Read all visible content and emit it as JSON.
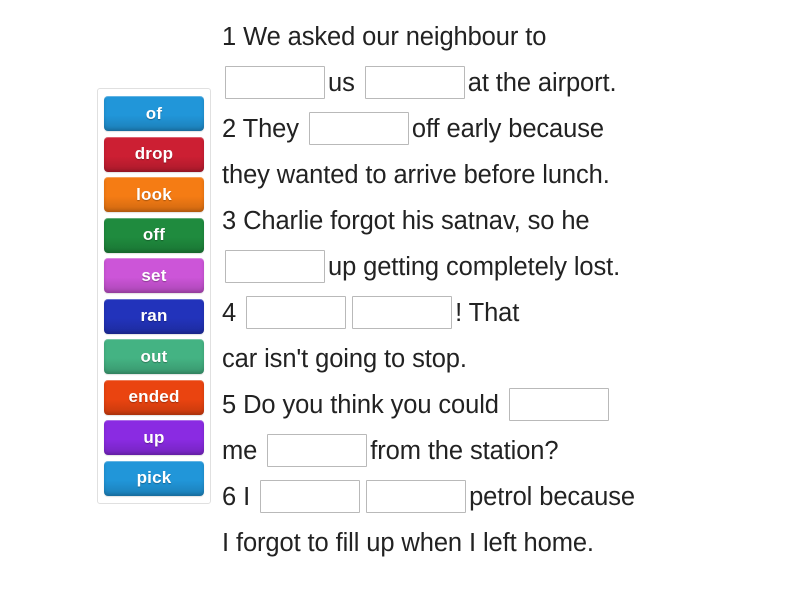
{
  "word_bank": {
    "name": "word-bank",
    "tiles": [
      {
        "label": "of",
        "color": "#2196d9"
      },
      {
        "label": "drop",
        "color": "#cc1f33"
      },
      {
        "label": "look",
        "color": "#f57c14"
      },
      {
        "label": "off",
        "color": "#1f8b3e"
      },
      {
        "label": "set",
        "color": "#cc55d8"
      },
      {
        "label": "ran",
        "color": "#2233bb"
      },
      {
        "label": "out",
        "color": "#44b383"
      },
      {
        "label": "ended",
        "color": "#ea4410"
      },
      {
        "label": "up",
        "color": "#8a2be2"
      },
      {
        "label": "pick",
        "color": "#2196d9"
      }
    ]
  },
  "exercise": {
    "lines": [
      {
        "number": "1",
        "segments": [
          {
            "type": "text",
            "value": "1 We asked our neighbour to"
          }
        ]
      },
      {
        "number": "1b",
        "segments": [
          {
            "type": "blank",
            "value": ""
          },
          {
            "type": "text",
            "value": "us"
          },
          {
            "type": "blank",
            "value": ""
          },
          {
            "type": "text",
            "value": "at the airport."
          }
        ]
      },
      {
        "number": "2",
        "segments": [
          {
            "type": "text",
            "value": "2 They"
          },
          {
            "type": "blank",
            "value": ""
          },
          {
            "type": "text",
            "value": "off early because"
          }
        ]
      },
      {
        "number": "2b",
        "segments": [
          {
            "type": "text",
            "value": "they wanted to arrive before lunch."
          }
        ]
      },
      {
        "number": "3",
        "segments": [
          {
            "type": "text",
            "value": "3 Charlie forgot his satnav, so he"
          }
        ]
      },
      {
        "number": "3b",
        "segments": [
          {
            "type": "blank",
            "value": ""
          },
          {
            "type": "text",
            "value": "up getting completely lost."
          }
        ]
      },
      {
        "number": "4",
        "segments": [
          {
            "type": "text",
            "value": "4"
          },
          {
            "type": "blank",
            "value": ""
          },
          {
            "type": "blank",
            "value": ""
          },
          {
            "type": "text",
            "value": "! That"
          }
        ]
      },
      {
        "number": "4b",
        "segments": [
          {
            "type": "text",
            "value": "car isn't going to stop."
          }
        ]
      },
      {
        "number": "5",
        "segments": [
          {
            "type": "text",
            "value": "5 Do you think you could"
          },
          {
            "type": "blank",
            "value": ""
          }
        ]
      },
      {
        "number": "5b",
        "segments": [
          {
            "type": "text",
            "value": "me"
          },
          {
            "type": "blank",
            "value": ""
          },
          {
            "type": "text",
            "value": "from the station?"
          }
        ]
      },
      {
        "number": "6",
        "segments": [
          {
            "type": "text",
            "value": "6 I"
          },
          {
            "type": "blank",
            "value": ""
          },
          {
            "type": "blank",
            "value": ""
          },
          {
            "type": "text",
            "value": "petrol because"
          }
        ]
      },
      {
        "number": "6b",
        "segments": [
          {
            "type": "text",
            "value": "I forgot to fill up when I left home."
          }
        ]
      }
    ]
  },
  "colors": {
    "page_background": "#ffffff",
    "text": "#222222",
    "blank_border": "#b9b9b9",
    "bank_border": "#e0e0e0"
  }
}
